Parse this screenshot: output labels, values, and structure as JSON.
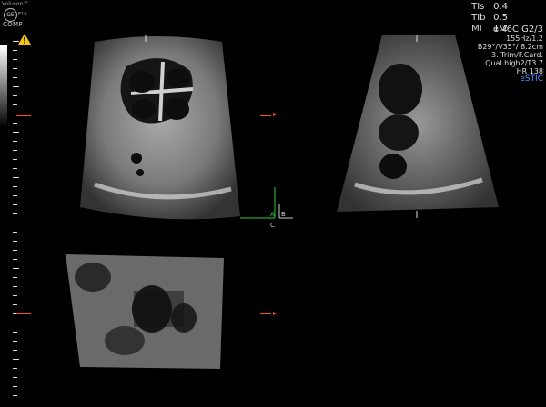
{
  "header": {
    "brand": "Voluson™",
    "logo": "GE",
    "probe_id": "E10",
    "mode": "COMP"
  },
  "indices": [
    {
      "label": "TIs",
      "value": "0.4"
    },
    {
      "label": "TIb",
      "value": "0.5"
    },
    {
      "label": "MI",
      "value": "1.2"
    }
  ],
  "params": {
    "probe": "eM6C G2/3",
    "lines": [
      "155Hz/1.2",
      "B29°/V35°/ 8.2cm",
      "3. Trim/F.Card.",
      "Qual high2/T3.7",
      "HR 138"
    ],
    "mode": "eSTIC"
  },
  "axes": {
    "a": "A",
    "b": "B",
    "c": "C"
  },
  "colors": {
    "accent": "#5d8cff",
    "marker": "#ff4a1a",
    "axis_a": "#2ecc40",
    "axis_b": "#dddddd"
  },
  "icons": {
    "warning": "warning-triangle-icon"
  }
}
